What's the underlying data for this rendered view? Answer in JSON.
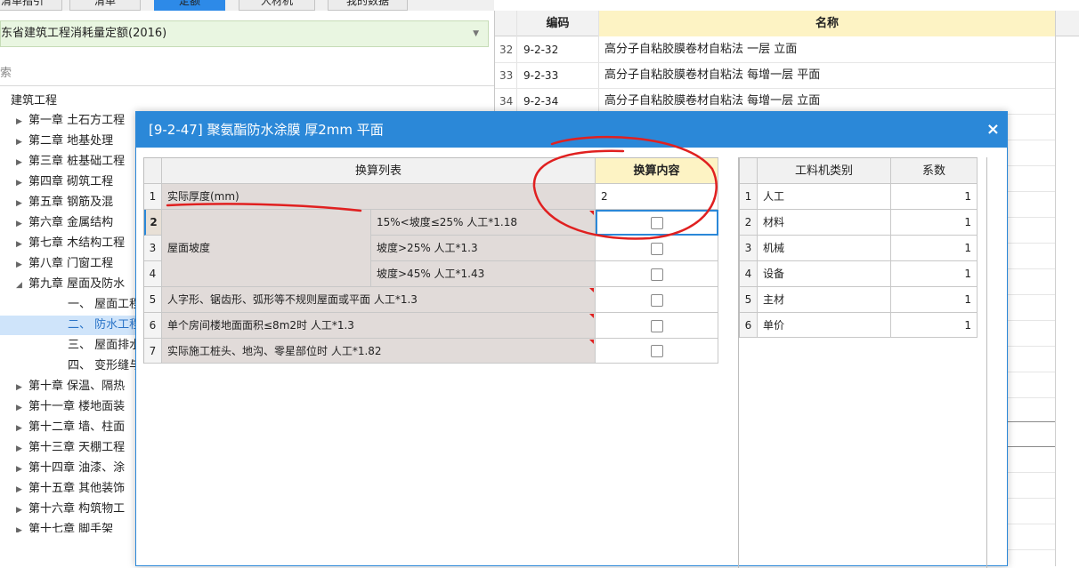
{
  "top_tabs": [
    "清单指引",
    "清单",
    "定额",
    "人材机",
    "我的数据"
  ],
  "library": {
    "selected": "东省建筑工程消耗量定额(2016)"
  },
  "search": {
    "placeholder": "索"
  },
  "tree": {
    "root": "建筑工程",
    "chapters": [
      "第一章 土石方工程",
      "第二章 地基处理",
      "第三章 桩基础工程",
      "第四章 砌筑工程",
      "第五章 钢筋及混",
      "第六章 金属结构",
      "第七章 木结构工程",
      "第八章 门窗工程",
      "第九章 屋面及防水"
    ],
    "sub_items": [
      "一、 屋面工程",
      "二、 防水工程",
      "三、 屋面排水",
      "四、 变形缝与"
    ],
    "later_chapters": [
      "第十章 保温、隔热",
      "第十一章 楼地面装",
      "第十二章 墙、柱面",
      "第十三章 天棚工程",
      "第十四章 油漆、涂",
      "第十五章 其他装饰",
      "第十六章 构筑物工",
      "第十七章 脚手架"
    ]
  },
  "grid": {
    "col_code": "编码",
    "col_name": "名称",
    "rows": [
      {
        "no": "32",
        "code": "9-2-32",
        "name": "高分子自粘胶膜卷材自粘法 一层 立面"
      },
      {
        "no": "33",
        "code": "9-2-33",
        "name": "高分子自粘胶膜卷材自粘法 每增一层 平面"
      },
      {
        "no": "34",
        "code": "9-2-34",
        "name": "高分子自粘胶膜卷材自粘法 每增一层 立面"
      }
    ]
  },
  "dialog": {
    "title": "[9-2-47] 聚氨酯防水涂膜 厚2mm 平面",
    "close": "×",
    "conv_header": "换算列表",
    "content_header": "换算内容",
    "rows": [
      {
        "no": "1",
        "label": "实际厚度(mm)",
        "value": "2"
      },
      {
        "no": "2",
        "label": "15%<坡度≤25% 人工*1.18"
      },
      {
        "no": "3",
        "label": "坡度>25% 人工*1.3"
      },
      {
        "no": "4",
        "label": "坡度>45% 人工*1.43"
      },
      {
        "no": "5",
        "label": "人字形、锯齿形、弧形等不规则屋面或平面 人工*1.3"
      },
      {
        "no": "6",
        "label": "单个房间楼地面面积≤8m2时 人工*1.3"
      },
      {
        "no": "7",
        "label": "实际施工桩头、地沟、零星部位时 人工*1.82"
      }
    ],
    "group_label": "屋面坡度",
    "category_header": "工料机类别",
    "coef_header": "系数",
    "categories": [
      {
        "no": "1",
        "name": "人工",
        "coef": "1"
      },
      {
        "no": "2",
        "name": "材料",
        "coef": "1"
      },
      {
        "no": "3",
        "name": "机械",
        "coef": "1"
      },
      {
        "no": "4",
        "name": "设备",
        "coef": "1"
      },
      {
        "no": "5",
        "name": "主材",
        "coef": "1"
      },
      {
        "no": "6",
        "name": "单价",
        "coef": "1"
      }
    ]
  },
  "colors": {
    "accent": "#2b88d8",
    "annotation": "#e02020",
    "row_gray": "#e1dbd9",
    "selected": "#cfe4fa"
  }
}
